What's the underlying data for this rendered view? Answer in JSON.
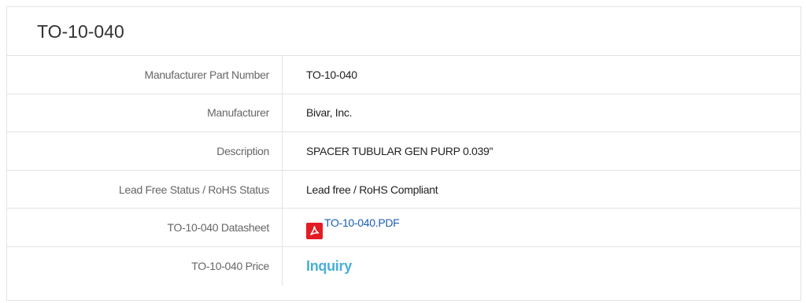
{
  "title": "TO-10-040",
  "rows": [
    {
      "label": "Manufacturer Part Number",
      "value": "TO-10-040"
    },
    {
      "label": "Manufacturer",
      "value": "Bivar, Inc."
    },
    {
      "label": "Description",
      "value": "SPACER TUBULAR GEN PURP 0.039\""
    },
    {
      "label": "Lead Free Status / RoHS Status",
      "value": "Lead free / RoHS Compliant"
    },
    {
      "label": "TO-10-040 Datasheet",
      "link_text": "TO-10-040.PDF",
      "icon": "pdf-icon"
    },
    {
      "label": "TO-10-040 Price",
      "link_text": "Inquiry"
    }
  ],
  "colors": {
    "pdf_icon": "#e31b23",
    "datasheet_link": "#1a5fb4",
    "inquiry_link": "#4aaed9",
    "border": "#e3e3e3"
  }
}
